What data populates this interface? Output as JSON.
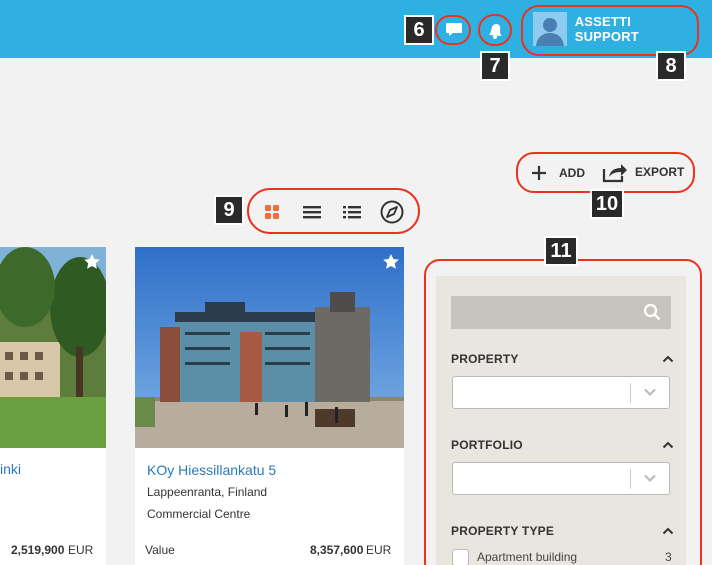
{
  "header": {
    "user_name": "ASSETTI SUPPORT",
    "accent_color": "#2fb0e3",
    "highlight_color": "#e8331f",
    "messages_icon": "speech-bubble-icon",
    "notifications_icon": "bell-icon"
  },
  "badges": {
    "b6": "6",
    "b7": "7",
    "b8": "8",
    "b9": "9",
    "b10": "10",
    "b11": "11"
  },
  "actions": {
    "add_label": "ADD",
    "export_label": "EXPORT"
  },
  "view_modes": [
    "grid-view",
    "list-view",
    "detailed-list-view",
    "map-view"
  ],
  "cards": [
    {
      "title": "inki",
      "value": "2,519,900",
      "currency": "EUR"
    },
    {
      "title": "KOy Hiessillankatu 5",
      "location": "Lappeenranta, Finland",
      "type": "Commercial Centre",
      "value_label": "Value",
      "value": "8,357,600",
      "currency": "EUR"
    }
  ],
  "filters": {
    "search_placeholder": "",
    "property_label": "PROPERTY",
    "property_value": "",
    "portfolio_label": "PORTFOLIO",
    "portfolio_value": "",
    "property_type_label": "PROPERTY TYPE",
    "property_types": [
      {
        "label": "Apartment building",
        "count": "3"
      }
    ]
  }
}
